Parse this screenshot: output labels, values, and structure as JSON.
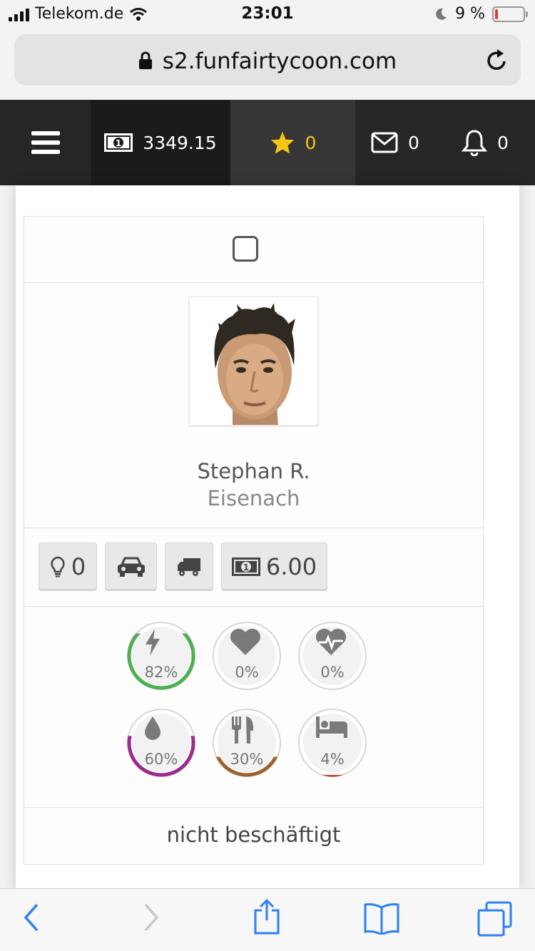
{
  "status_bar": {
    "carrier": "Telekom.de",
    "time": "23:01",
    "battery_percent": "9 %",
    "battery_level": 0.09
  },
  "browser": {
    "url": "s2.funfairtycoon.com"
  },
  "header": {
    "money": "3349.15",
    "stars": "0",
    "messages": "0",
    "notifications": "0"
  },
  "profile": {
    "name": "Stephan R.",
    "city": "Eisenach",
    "ideas": "0",
    "wage": "6.00",
    "employment_status": "nicht beschäftigt"
  },
  "gauges": [
    {
      "icon": "energy-icon",
      "value": "82%",
      "level": 0.82,
      "color": "#4caf50"
    },
    {
      "icon": "heart-icon",
      "value": "0%",
      "level": 0.0,
      "color": "#9e9e9e"
    },
    {
      "icon": "heartbeat-icon",
      "value": "0%",
      "level": 0.0,
      "color": "#9e9e9e"
    },
    {
      "icon": "water-drop-icon",
      "value": "60%",
      "level": 0.6,
      "color": "#9c2a8f"
    },
    {
      "icon": "fork-knife-icon",
      "value": "30%",
      "level": 0.3,
      "color": "#a0622d"
    },
    {
      "icon": "bed-icon",
      "value": "4%",
      "level": 0.04,
      "color": "#c62828"
    }
  ]
}
